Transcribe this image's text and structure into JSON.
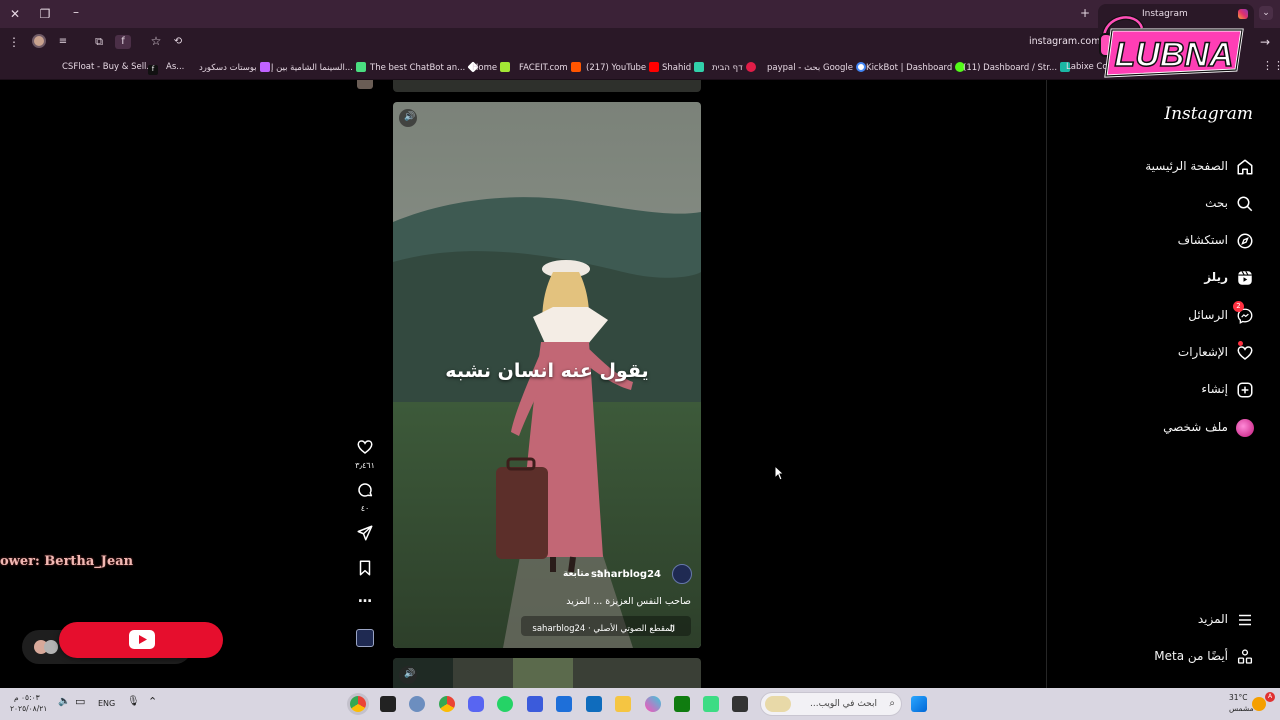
{
  "browser": {
    "tab_title": "Instagram",
    "url": "instagram.com/",
    "bookmarks": [
      {
        "label": "CSFloat - Buy & Sell...",
        "color": "#3b5bdb"
      },
      {
        "label": "As...",
        "color": "#111111"
      },
      {
        "label": "بوستات دسكورد",
        "color": "#c062ff"
      },
      {
        "label": "السينما الشامية بين إ...",
        "color": "#4ade80"
      },
      {
        "label": "The best ChatBot an...",
        "color": "#ffffff"
      },
      {
        "label": "Home",
        "color": "#a3e635"
      },
      {
        "label": "FACEIT.com",
        "color": "#ff5500"
      },
      {
        "label": "(217) YouTube",
        "color": "#ff0000"
      },
      {
        "label": "Shahid",
        "color": "#31d0aa"
      },
      {
        "label": "דף הבית",
        "color": "#e11d48"
      },
      {
        "label": "paypal - بحث Google",
        "color": "#4285f4"
      },
      {
        "label": "KickBot | Dashboard",
        "color": "#53fc18"
      },
      {
        "label": "(11) Dashboard / Str...",
        "color": "#1bb6a4"
      },
      {
        "label": "Labixe Coin",
        "color": "#ffd54a"
      }
    ]
  },
  "overlay": {
    "logo_text": "LUBNA",
    "follower_text": "ower: Bertha_Jean"
  },
  "sidebar": {
    "logo": "Instagram",
    "items": [
      {
        "label": "الصفحة الرئيسية",
        "icon": "home-icon"
      },
      {
        "label": "بحث",
        "icon": "search-icon"
      },
      {
        "label": "استكشاف",
        "icon": "explore-icon"
      },
      {
        "label": "ريلز",
        "icon": "reels-icon"
      },
      {
        "label": "الرسائل",
        "icon": "messenger-icon",
        "badge": "2"
      },
      {
        "label": "الإشعارات",
        "icon": "heart-icon"
      },
      {
        "label": "إنشاء",
        "icon": "create-icon"
      },
      {
        "label": "ملف شخصي",
        "icon": "avatar"
      }
    ],
    "more": "المزيد",
    "meta": "أيضًا من Meta"
  },
  "reel": {
    "caption": "يقول عنه انسان نشبه",
    "username": "saharblog24",
    "follow": "متابعة",
    "description": "صاحب النفس العزيزة ... المزيد",
    "audio": "المقطع الصوتي الأصلي · saharblog24",
    "likes": "٣٫٤٦١",
    "comments": "٤٠"
  },
  "taskbar": {
    "time": "٠٥:٠٣ م",
    "date": "٢٠٢٥/٠٨/٢١",
    "lang": "ENG",
    "search_placeholder": "ابحث في الويب...",
    "temp": "31°C",
    "weather": "مشمس"
  }
}
